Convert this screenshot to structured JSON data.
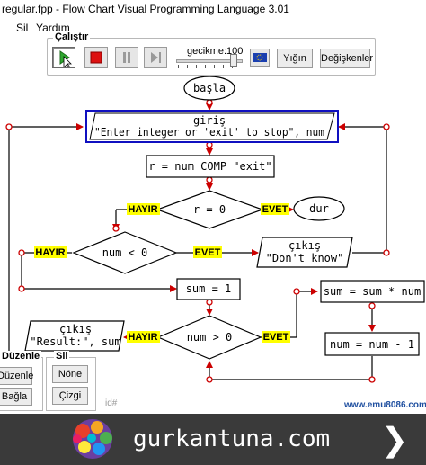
{
  "window": {
    "title": "regular.fpp - Flow Chart Visual Programming Language 3.01"
  },
  "menu": {
    "items": [
      "Sil",
      "Yardım"
    ]
  },
  "run_toolbar": {
    "legend": "Çalıştır",
    "delay_label": "gecikme:100",
    "stack_label": "Yığın",
    "variables_label": "Değişkenler"
  },
  "flow": {
    "start": "başla",
    "input_title": "giriş",
    "input_prompt": "\"Enter integer or 'exit' to stop\", num",
    "compare_assign": "r = num COMP \"exit\"",
    "cond_r": "r = 0",
    "end": "dur",
    "cond_neg": "num < 0",
    "out1_title": "çıkış",
    "out1_text": "\"Don't know\"",
    "assign_sum": "sum = 1",
    "loop_cond": "num > 0",
    "out2_title": "çıkış",
    "out2_text": "\"Result:\", sum",
    "mul_assign": "sum = sum * num",
    "dec_assign": "num = num - 1",
    "yes_label": "EVET",
    "no_label": "HAYIR"
  },
  "edit_panel": {
    "legend": "Düzenle",
    "edit_btn": "Düzenle",
    "connect_btn": "Bağla"
  },
  "delete_panel": {
    "legend": "Sil",
    "node_btn": "Nöne",
    "line_btn": "Çizgi"
  },
  "watermark": {
    "id": "id#",
    "site": "www.emu8086.com"
  },
  "banner": {
    "text": "gurkantuna.com"
  },
  "colors": {
    "yes_no_bg": "#ffff00",
    "arrow": "#cc0000",
    "selection": "#1010c0",
    "play": "#2fa82f",
    "stop": "#dd1111"
  }
}
